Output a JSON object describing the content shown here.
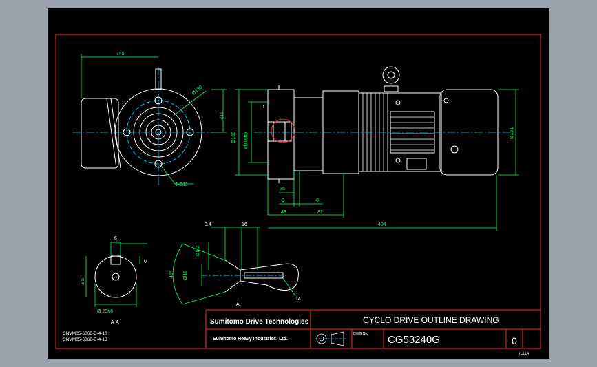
{
  "colors": {
    "background": "#9aa3ad",
    "canvas": "#000000",
    "border": "#ff2a2a",
    "dimension": "#00ff66",
    "object": "#ffffff",
    "centerline": "#00c8ff",
    "text_accent": "#ff2a2a"
  },
  "title_block": {
    "brand": "Sumitomo Drive Technologies",
    "company": "Sumitomo Heavy Industries, Ltd.",
    "title": "CYCLO DRIVE OUTLINE DRAWING",
    "drawing_no_label": "DWG.No.",
    "drawing_no": "CG53240G",
    "revision": "0",
    "sheet": "1-446"
  },
  "notes": {
    "line1": "CNVM05-6060-B-4-10",
    "line2": "CNVM05-6060-B-4-13",
    "section": "A-A"
  },
  "dims": {
    "d145": "145",
    "d112": "112",
    "d130": "Ø130",
    "d4holes": "4-Ø11",
    "d160": "Ø160",
    "d110": "Ø110h6",
    "d35": "35",
    "d3": "3",
    "d8": "8",
    "d48": "48",
    "d81": "81",
    "d404": "404",
    "d151": "Ø151",
    "d34": "3.4",
    "d16": "16",
    "d6": "6",
    "d0": "0",
    "d35b": "3.5",
    "d286": "Ø 28h6",
    "d52": "Ø5.2",
    "d40": "40°",
    "d18": "Ø18",
    "d14": "14",
    "dt": "t",
    "dA": "A"
  }
}
